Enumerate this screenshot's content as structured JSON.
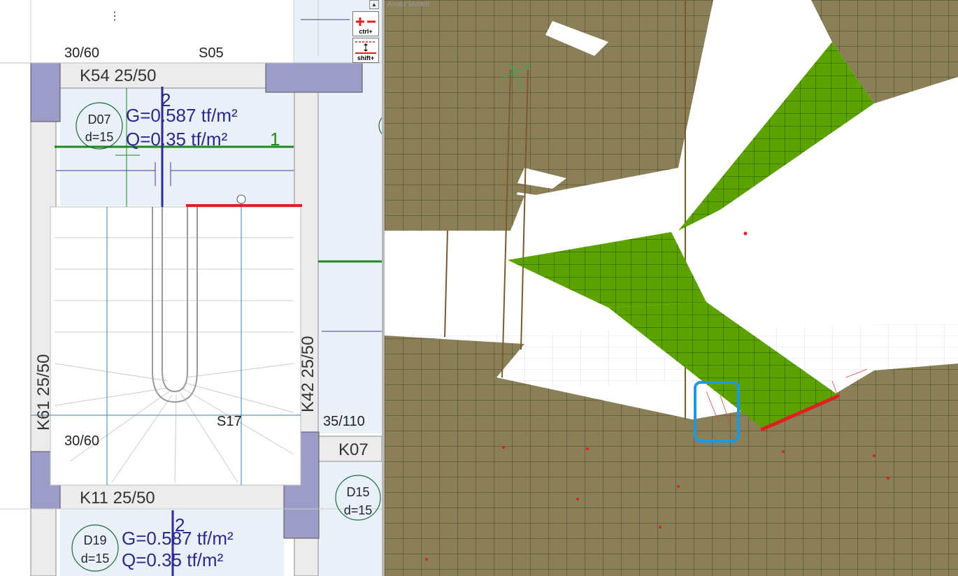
{
  "plan": {
    "column_top_left": "30/60",
    "slab_top_label": "S05",
    "beam_top": "K54 25/50",
    "slab_top": {
      "id": "D07",
      "thickness": "d=15",
      "dead_load": "G=0.587 tf/m²",
      "live_load": "Q=0.35 tf/m²"
    },
    "axis_mark_top_2": "2",
    "axis_mark_top_1": "1",
    "beam_left": "K61 25/50",
    "beam_right": "K42 25/50",
    "stair_label": "S17",
    "column_bottom_left": "30/60",
    "column_bottom_right": "35/110",
    "beam_right_lower": "K07",
    "beam_bottom": "K11 25/50",
    "slab_right": {
      "id": "D15",
      "thickness": "d=15"
    },
    "slab_bottom": {
      "id": "D19",
      "thickness": "d=15",
      "dead_load": "G=0.587 tf/m²",
      "live_load": "Q=0.35 tf/m²"
    },
    "axis_mark_bottom_2": "2",
    "dots_icon": "⋮"
  },
  "toolbar": {
    "ctrl_label": "ctrl+",
    "shift_label": "shift+",
    "scroll_up_icon": "▲"
  },
  "view3d": {
    "title": "Analiz Modeli"
  },
  "colors": {
    "slab_fill": "#8b7f57",
    "stair_fill": "#5ca300",
    "highlight_red": "#e02020",
    "selection_blue": "#1a9ae0",
    "plan_blue": "#2a2a8a"
  }
}
